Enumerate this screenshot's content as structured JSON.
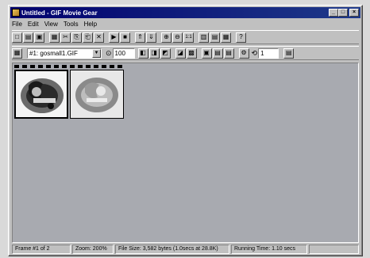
{
  "window": {
    "title": "Untitled - GIF Movie Gear",
    "controls": {
      "minimize": "_",
      "maximize": "□",
      "close": "×"
    }
  },
  "menu": [
    {
      "label": "File",
      "icon": ""
    },
    {
      "label": "Edit"
    },
    {
      "label": "View"
    },
    {
      "label": "Tools"
    },
    {
      "label": "Help"
    }
  ],
  "toolbar1": {
    "buttons": [
      "new-icon",
      "open-icon",
      "save-icon",
      "insert-frame-icon",
      "cut-icon",
      "copy-icon",
      "paste-icon",
      "delete-icon",
      "play-icon",
      "stop-icon",
      "move-up-icon",
      "move-down-icon",
      "zoom-in-icon",
      "zoom-out-icon",
      "zoom-actual-icon",
      "view-frames-icon",
      "view-filmstrip-icon",
      "view-animation-icon",
      "help-icon"
    ],
    "glyphs": [
      "□",
      "▤",
      "▣",
      "▦",
      "✂",
      "⎘",
      "⎗",
      "✕",
      "▶",
      "■",
      "⇑",
      "⇓",
      "⊕",
      "⊖",
      "1:1",
      "▥",
      "▤",
      "▦",
      "?"
    ]
  },
  "toolbar2": {
    "frame_select": "#1: gosmall1.GIF",
    "delay_value": "100",
    "loop_value": "1",
    "glyphs": [
      "▦",
      "◧",
      "◨",
      "◩",
      "◪",
      "▩",
      "▣",
      "▤",
      "⚙",
      "⟲",
      "▤"
    ]
  },
  "status": {
    "frame": "Frame #1 of 2",
    "zoom": "Zoom: 200%",
    "file_size": "File Size: 3,582 bytes (1.0secs at 28.8K)",
    "running_time": "Running Time: 1.10 secs"
  },
  "colors": {
    "title_bar": "#00006e",
    "workspace": "#a8aab0",
    "chrome": "#c0c0c0"
  }
}
